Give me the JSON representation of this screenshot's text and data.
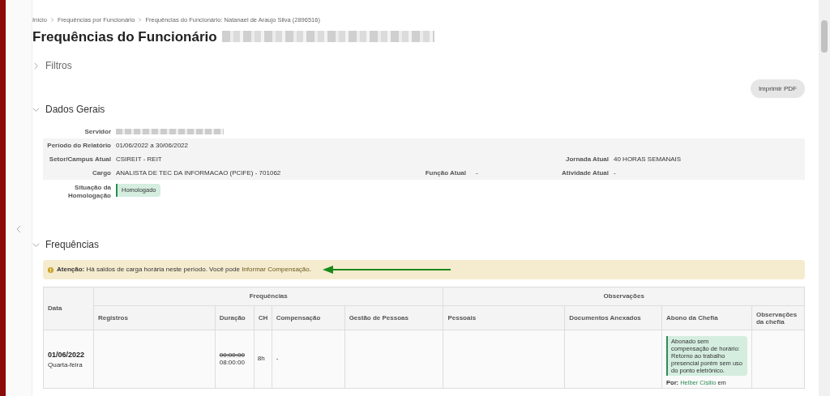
{
  "breadcrumbs": [
    {
      "label": "Início"
    },
    {
      "label": "Frequências por Funcionário"
    },
    {
      "label": "Frequências do Funcionário: Natanael de Araujo Silva (2896516)"
    }
  ],
  "page_title": "Frequências do Funcionário",
  "filters": {
    "title": "Filtros",
    "expanded": false
  },
  "print_button": "Imprimir PDF",
  "general": {
    "title": "Dados Gerais",
    "expanded": true,
    "fields": [
      {
        "label": "Servidor",
        "redacted": true
      },
      {
        "label": "Período do Relatório",
        "value": "01/06/2022 a 30/06/2022"
      },
      {
        "label": "Setor/Campus Atual",
        "value": "CSIREIT - REIT",
        "label_2": "Jornada Atual",
        "value_2": "40 HORAS SEMANAIS"
      },
      {
        "label": "Cargo",
        "value": "ANALISTA DE TEC DA INFORMACAO (PCIFE) - 701062",
        "label_3": "Função Atual",
        "value_3": "-",
        "label_2": "Atividade Atual",
        "value_2": "-"
      }
    ],
    "status_label": "Situação da Homologação",
    "status": "Homologado"
  },
  "frequencies": {
    "title": "Frequências",
    "expanded": true,
    "alert": "**Atenção:** Há saldos de carga horária neste período. Você pode ",
    "alert_link": "Informar Compensação",
    "alert_end": ".",
    "table": {
      "groups": [
        "Data",
        "Frequências",
        "Observações"
      ],
      "columns": [
        "Registros",
        "Duração",
        "CH",
        "Compensação",
        "Gestão de Pessoas",
        "Pessoais",
        "Documentos Anexados",
        "Abono da Chefia",
        "Observações da chefia"
      ],
      "rows": [
        {
          "date": "01/06/2022",
          "weekday": "Quarta-feira",
          "duration_old": "00:00:00",
          "duration": "08:00:00",
          "ch": "8h",
          "compensation": "-",
          "abono": "Abonado sem compensação de horário: Retorno ao trabalho presencial porém sem uso do ponto eletrônico.",
          "by_label": "Por:",
          "by_name": "Helber Cisilio",
          "by_end": "em"
        }
      ]
    }
  }
}
